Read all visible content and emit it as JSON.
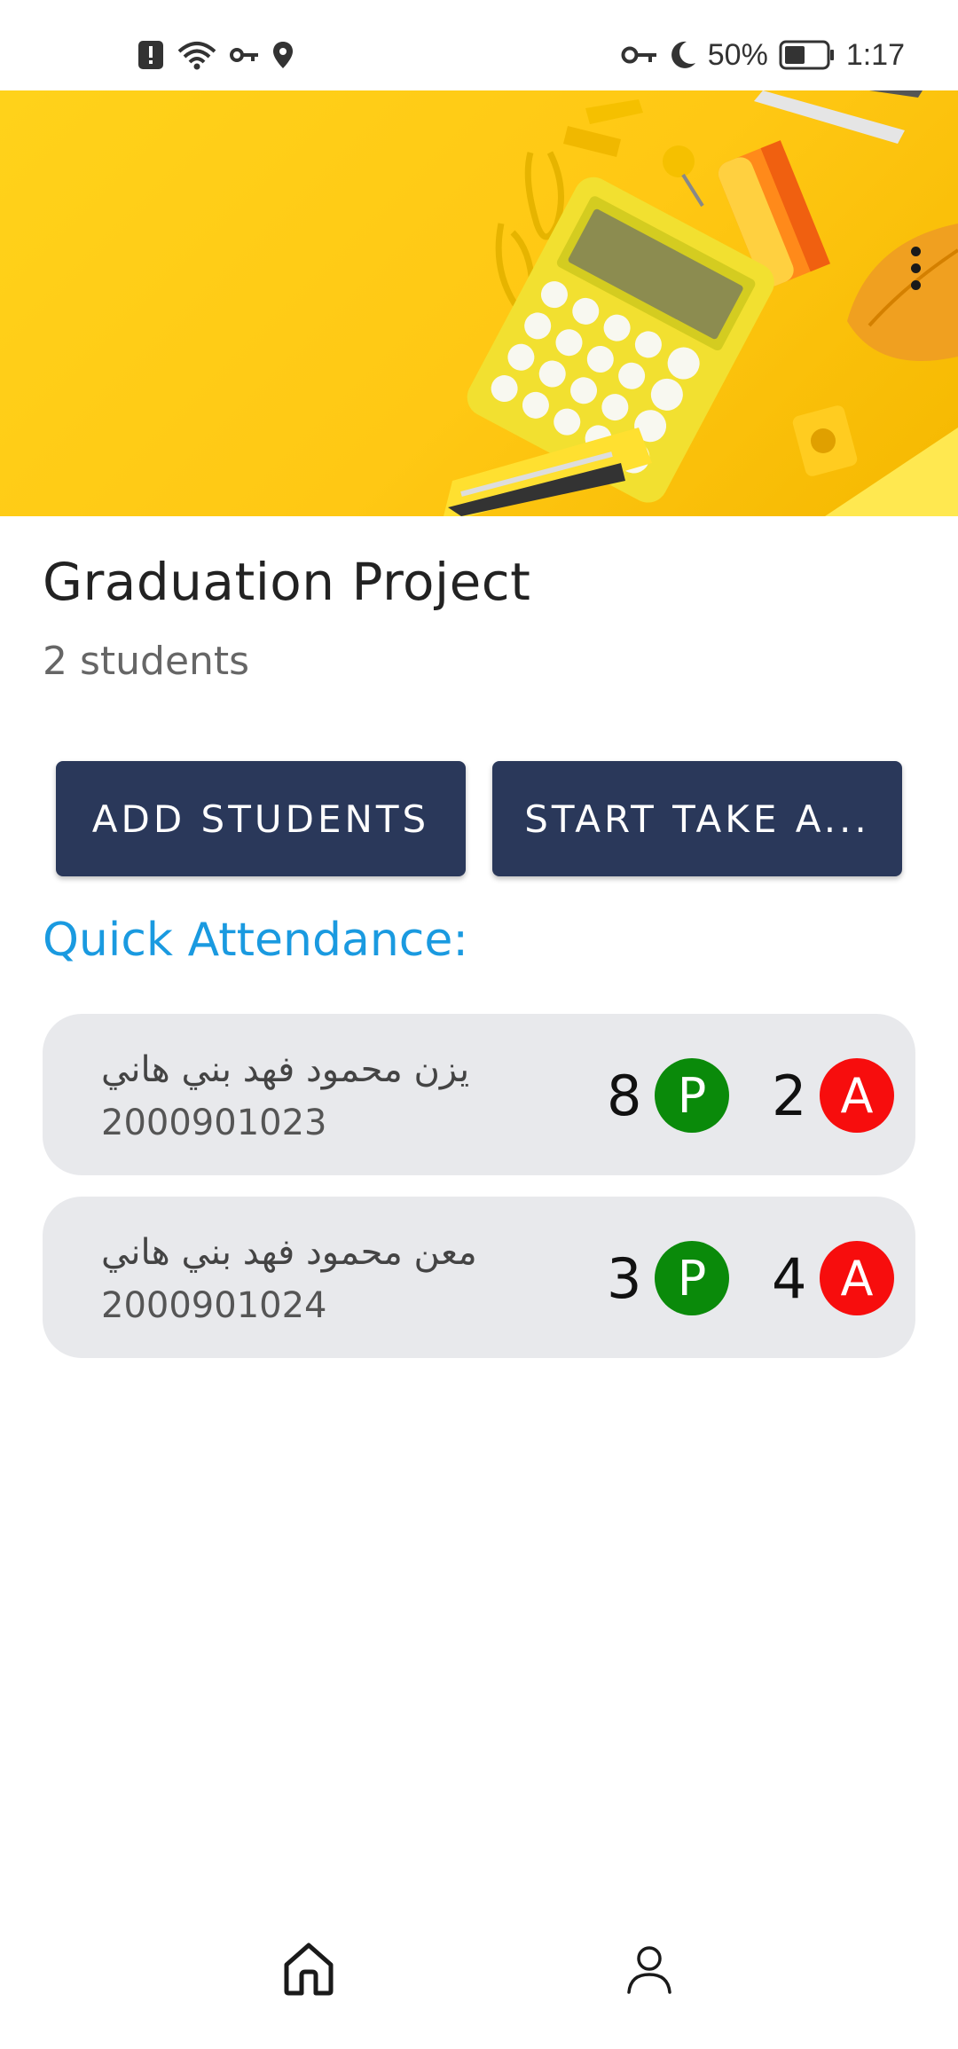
{
  "status_bar": {
    "battery_percent": "50%",
    "time": "1:17",
    "left_icons": [
      "alert-icon",
      "wifi-icon",
      "key-icon",
      "location-icon"
    ],
    "right_icons": [
      "key-icon",
      "moon-icon",
      "battery-icon"
    ]
  },
  "banner": {
    "menu_icon": "more-vert-icon"
  },
  "course": {
    "title": "Graduation Project",
    "student_count": "2 students"
  },
  "actions": {
    "add_students_label": "ADD STUDENTS",
    "start_attendance_label": "START TAKE A..."
  },
  "quick_attendance": {
    "heading": "Quick Attendance:",
    "students": [
      {
        "name": "يزن محمود فهد بني هاني",
        "id": "2000901023",
        "present_count": "8",
        "absent_count": "2",
        "present_label": "P",
        "absent_label": "A"
      },
      {
        "name": "معن محمود فهد بني هاني",
        "id": "2000901024",
        "present_count": "3",
        "absent_count": "4",
        "present_label": "P",
        "absent_label": "A"
      }
    ]
  },
  "colors": {
    "primary_button": "#2a385a",
    "accent_heading": "#1a9ae0",
    "present_badge": "#0a8a0a",
    "absent_badge": "#f70d0d",
    "card_bg": "#e8e9ec"
  },
  "bottom_nav": {
    "items": [
      "home-icon",
      "profile-icon"
    ]
  }
}
